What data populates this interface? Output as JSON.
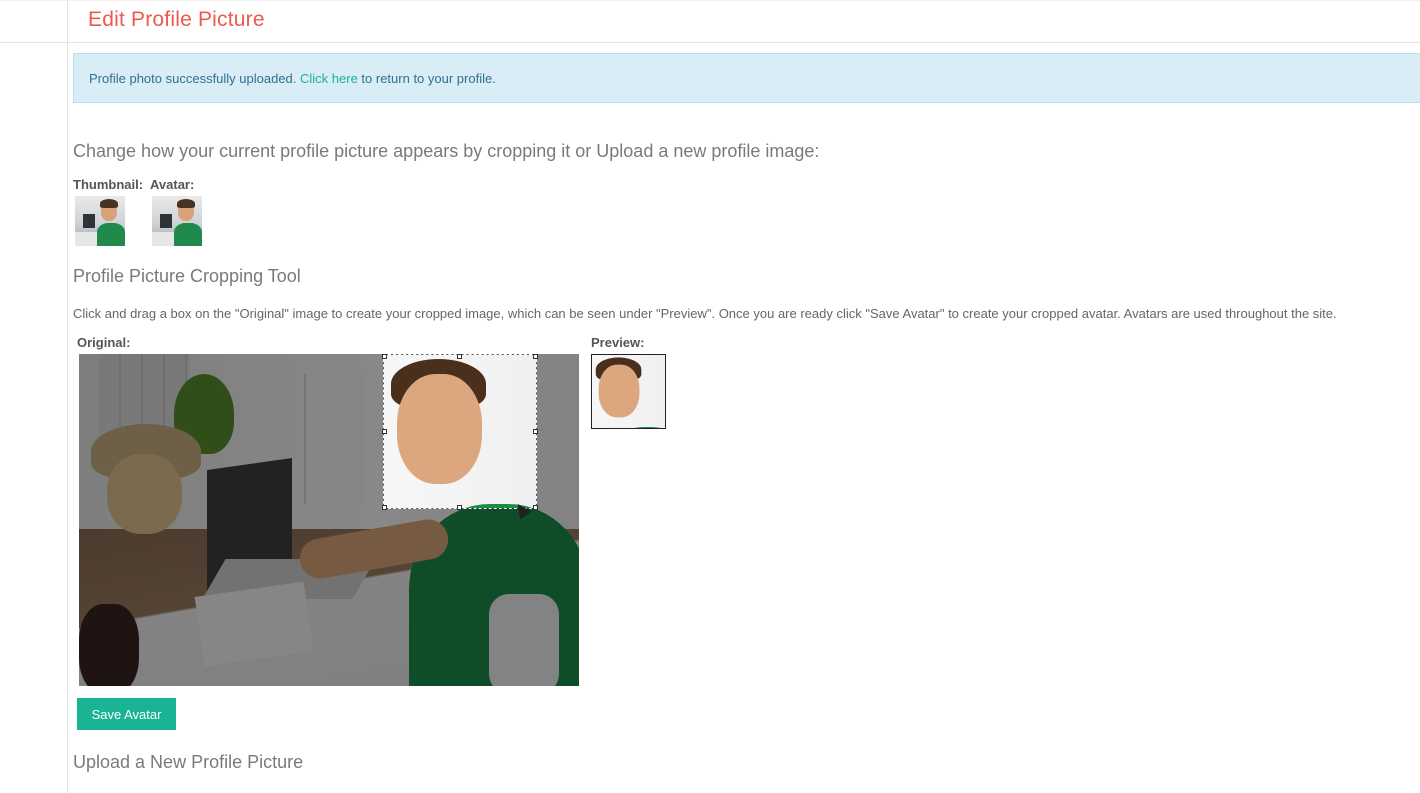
{
  "header": {
    "title": "Edit Profile Picture"
  },
  "alert": {
    "message_before": "Profile photo successfully uploaded. ",
    "link_text": "Click here",
    "message_after": " to return to your profile."
  },
  "intro": {
    "text": "Change how your current profile picture appears by cropping it or Upload a new profile image:",
    "thumbnail_label": "Thumbnail:",
    "avatar_label": "Avatar:"
  },
  "cropping": {
    "title": "Profile Picture Cropping Tool",
    "instructions": "Click and drag a box on the \"Original\" image to create your cropped image, which can be seen under \"Preview\". Once you are ready click \"Save Avatar\" to create your cropped avatar. Avatars are used throughout the site.",
    "original_label": "Original:",
    "preview_label": "Preview:",
    "save_label": "Save Avatar"
  },
  "upload": {
    "title": "Upload a New Profile Picture"
  },
  "colors": {
    "title_red": "#ec5a4f",
    "accent_teal": "#1ab394",
    "alert_bg": "#d9edf6"
  }
}
